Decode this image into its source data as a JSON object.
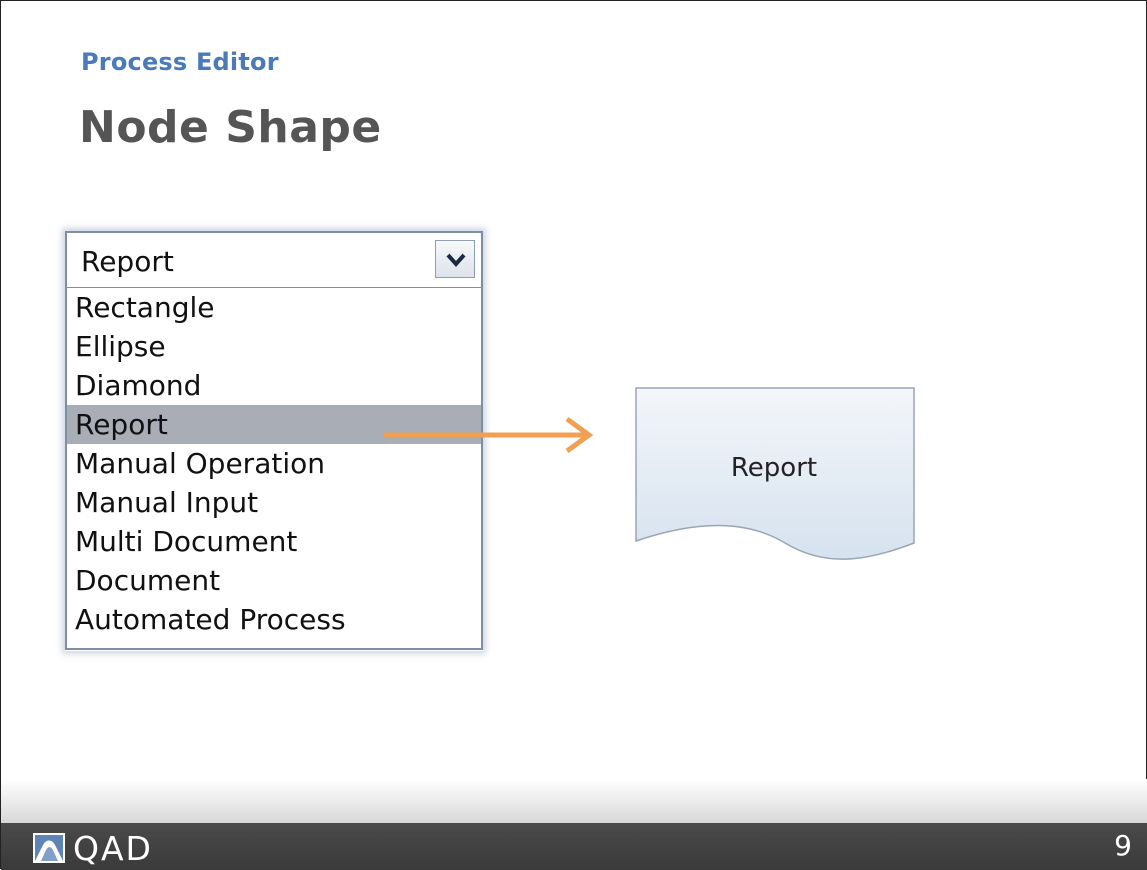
{
  "header": {
    "section": "Process Editor",
    "title": "Node Shape"
  },
  "node_shape_select": {
    "selected_value": "Report",
    "options": [
      "Rectangle",
      "Ellipse",
      "Diamond",
      "Report",
      "Manual Operation",
      "Manual Input",
      "Multi Document",
      "Document",
      "Automated Process"
    ],
    "highlighted_option": "Report"
  },
  "preview": {
    "shape_label": "Report"
  },
  "footer": {
    "brand": "QAD",
    "page_number": "9"
  },
  "colors": {
    "section_label": "#4a7ab8",
    "title": "#555555",
    "highlight": "#a9adb6",
    "arrow": "#f0a050",
    "shape_fill_top": "#f3f6fa",
    "shape_fill_bottom": "#d6e2ef",
    "footer_bar": "#404040"
  },
  "icons": {
    "dropdown_toggle": "chevron-down-icon",
    "pointer": "arrow-right-icon",
    "logo": "qad-logo-icon"
  }
}
